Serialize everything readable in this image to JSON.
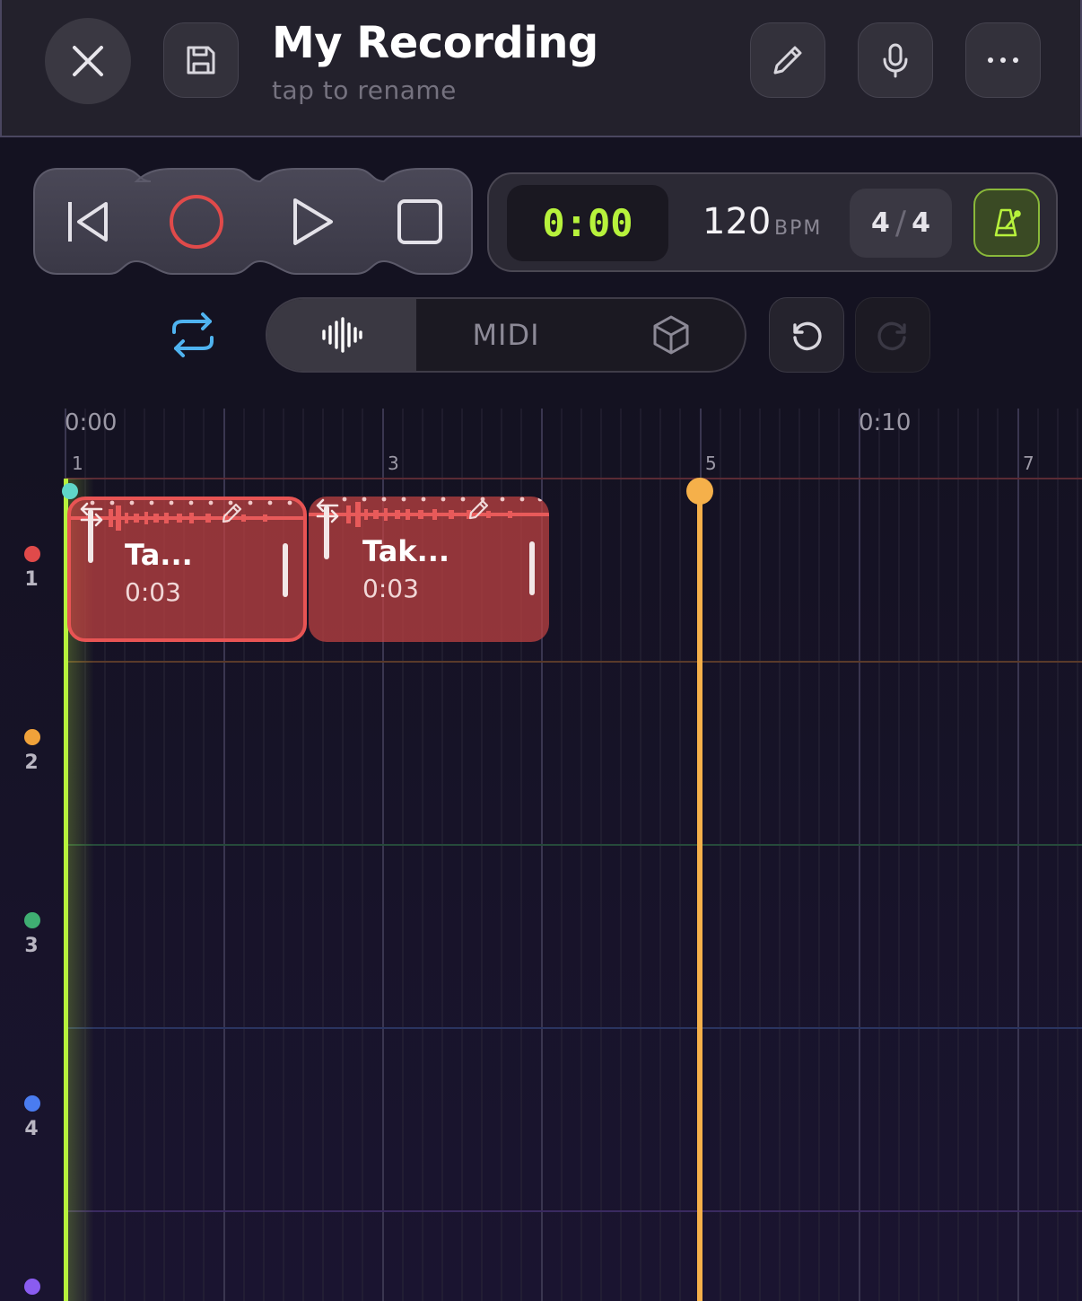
{
  "header": {
    "title": "My Recording",
    "subtitle": "tap to rename",
    "icons": [
      "close-icon",
      "save-icon",
      "pencil-icon",
      "mic-icon",
      "more-icon"
    ]
  },
  "transport": {
    "icons": [
      "skip-back-icon",
      "record-icon",
      "play-icon",
      "stop-icon"
    ],
    "record_color": "#e04a4a"
  },
  "timecode": {
    "time": "0:00",
    "bpm": "120",
    "bpm_unit": "BPM",
    "sig_top": "4",
    "sig_slash": "/",
    "sig_bottom": "4",
    "time_color": "#b7f23c"
  },
  "modes": {
    "midi_label": "MIDI",
    "icons": [
      "loop-icon",
      "waveform-icon",
      "cube-icon",
      "undo-icon",
      "redo-icon"
    ]
  },
  "ruler": {
    "time_labels": [
      "0:00",
      "0:10"
    ],
    "bar_labels": [
      "1",
      "3",
      "5",
      "7"
    ]
  },
  "tracks": [
    {
      "number": "1",
      "color": "#e04a4a"
    },
    {
      "number": "2",
      "color": "#f0a23a"
    },
    {
      "number": "3",
      "color": "#3fae72"
    },
    {
      "number": "4",
      "color": "#4a7cf0"
    },
    {
      "number": "",
      "color": "#8a5cf0"
    }
  ],
  "clips": [
    {
      "name": "Ta...",
      "duration": "0:03"
    },
    {
      "name": "Tak...",
      "duration": "0:03"
    }
  ],
  "colors": {
    "playhead": "#b7f23c",
    "loop_marker": "#f5b04a",
    "clip": "#c44242"
  }
}
